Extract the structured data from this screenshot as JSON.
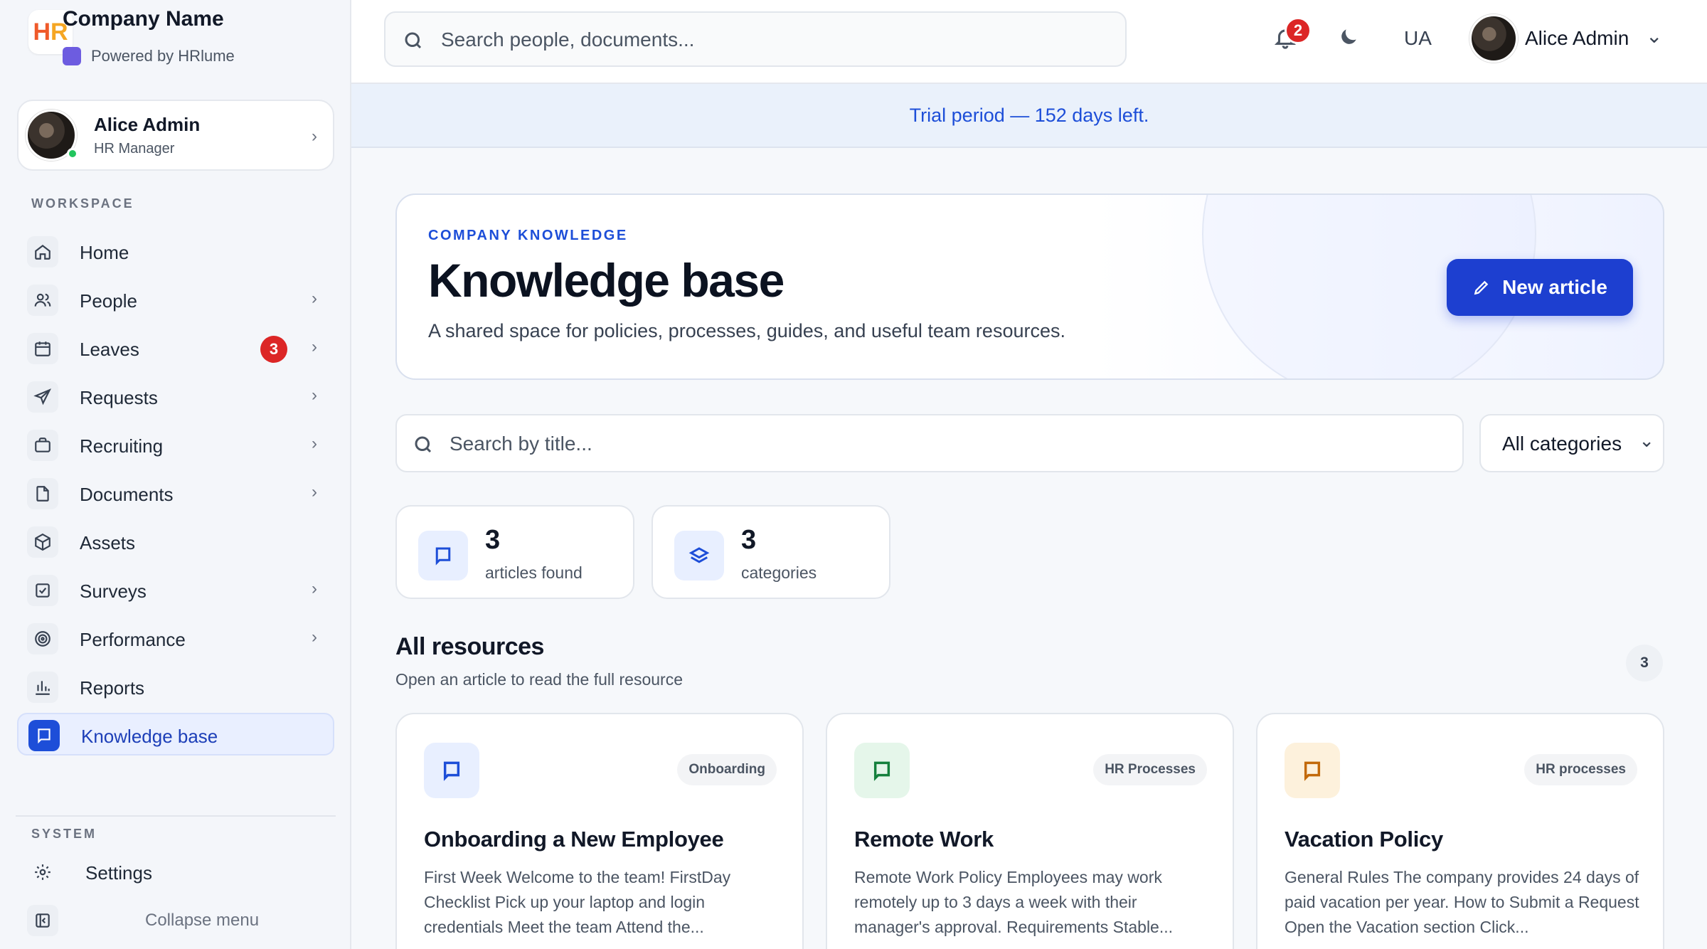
{
  "brand": {
    "logo_text_a": "H",
    "logo_text_b": "R",
    "name": "Company Name",
    "powered": "Powered by HRlume"
  },
  "user": {
    "name": "Alice Admin",
    "role": "HR Manager"
  },
  "sidebar": {
    "workspace_label": "WORKSPACE",
    "items": [
      {
        "label": "Home"
      },
      {
        "label": "People"
      },
      {
        "label": "Leaves",
        "badge": "3"
      },
      {
        "label": "Requests"
      },
      {
        "label": "Recruiting"
      },
      {
        "label": "Documents"
      },
      {
        "label": "Assets"
      },
      {
        "label": "Surveys"
      },
      {
        "label": "Performance"
      },
      {
        "label": "Reports"
      },
      {
        "label": "Knowledge base"
      }
    ],
    "system_label": "SYSTEM",
    "settings_label": "Settings",
    "collapse_label": "Collapse menu"
  },
  "topbar": {
    "search_placeholder": "Search people, documents...",
    "notifications_count": "2",
    "language": "UA",
    "user_name": "Alice Admin"
  },
  "trial": {
    "text": "Trial period — 152 days left."
  },
  "hero": {
    "eyebrow": "COMPANY KNOWLEDGE",
    "title": "Knowledge base",
    "subtitle": "A shared space for policies, processes, guides, and useful team resources.",
    "new_article_label": "New article"
  },
  "filters": {
    "search_placeholder": "Search by title...",
    "category_selected": "All categories"
  },
  "stats": [
    {
      "value": "3",
      "caption": "articles found"
    },
    {
      "value": "3",
      "caption": "categories"
    }
  ],
  "resources": {
    "title": "All resources",
    "subtitle": "Open an article to read the full resource",
    "count": "3",
    "cards": [
      {
        "tag": "Onboarding",
        "title": "Onboarding a New Employee",
        "description": "First Week Welcome to the team! FirstDay Checklist Pick up your laptop and login credentials Meet the team Attend the...",
        "icon_color": "#1d4ed8",
        "icon_bg": "#e8efff"
      },
      {
        "tag": "HR Processes",
        "title": "Remote Work",
        "description": "Remote Work Policy Employees may work remotely up to 3 days a week with their manager's approval. Requirements Stable...",
        "icon_color": "#15803d",
        "icon_bg": "#e5f6ea"
      },
      {
        "tag": "HR processes",
        "title": "Vacation Policy",
        "description": "General Rules The company provides 24 days of paid vacation per year. How to Submit a Request Open the Vacation section Click...",
        "icon_color": "#c2690a",
        "icon_bg": "#fdf1dc"
      }
    ]
  }
}
